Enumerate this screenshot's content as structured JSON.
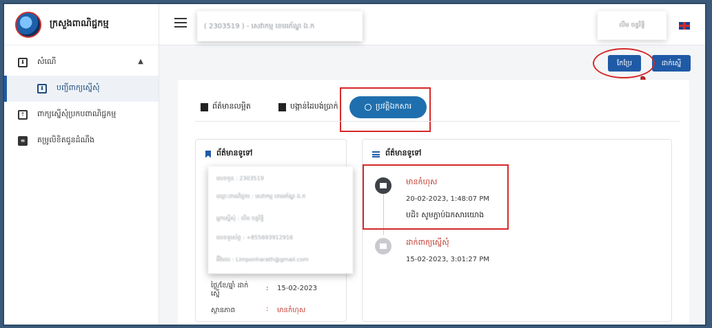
{
  "sidebar": {
    "brand": "ក្រសួងពាណិជ្ជកម្ម",
    "items": [
      {
        "label": "សំណើ",
        "icon": "inbox-icon"
      },
      {
        "label": "បញ្ជីពាក្យស្នើសុំ",
        "icon": "inbox-icon"
      },
      {
        "label": "ពាក្យស្នើសុំប្រកបពាណិជ្ជកម្ម",
        "icon": "file-upload-icon"
      },
      {
        "label": "គម្រូលិខិតជូនដំណឹង",
        "icon": "document-icon"
      }
    ]
  },
  "topbar": {
    "title": "( 2303519 ) - សេវាកម្ម ខេមរភ័ណ្ឌ ឯ.ក",
    "user": "លីម ចន្ទរិទ្ធិ"
  },
  "actions": {
    "edit_label": "កែប្រែ",
    "submit_label": "ដាក់ស្នើ"
  },
  "tabs": [
    {
      "label": "ព័ត៌មានលម្អិត"
    },
    {
      "label": "បង្កាន់ដៃបង់ប្រាក់"
    },
    {
      "label": "ប្រវត្តិឯកសារ"
    }
  ],
  "left_panel": {
    "heading": "ព័ត៌មានទូទៅ",
    "blurred_rows": [
      {
        "label": "លេខកូដ",
        "value": "2303519"
      },
      {
        "label": "ឈ្មោះពាណិជ្ជករ",
        "value": "សេវាកម្ម ខេមរភ័ណ្ឌ ឯ.ក"
      },
      {
        "label": "អ្នកស្នើសុំ",
        "value": "លីម ចន្ទរិទ្ធិ"
      },
      {
        "label": "លេខទូរស័ព្ទ",
        "value": "+855693912916"
      },
      {
        "label": "អ៊ីមែល",
        "value": "Limponharath@gmail.com"
      }
    ],
    "date_label": "ថ្ងៃ/ខែ/ឆ្នាំ ដាក់ស្នើ",
    "date_value": "15-02-2023",
    "status_label": "ស្ថានភាព",
    "status_value": "មានកំហុស",
    "colon": ":"
  },
  "right_panel": {
    "heading": "ព័ត៌មានទូទៅ",
    "timeline": [
      {
        "title": "មានកំហុស",
        "date": "20-02-2023, 1:48:07 PM",
        "note": "បដិ៖ សូមភ្ជាប់ឯកសារយោង"
      },
      {
        "title": "ដាក់ពាក្យស្នើសុំ",
        "date": "15-02-2023, 3:01:27 PM"
      }
    ]
  },
  "colors": {
    "primary": "#1f5aa6",
    "tab_active": "#1f6fae",
    "error_text": "#c0392b",
    "highlight": "#d62828"
  }
}
